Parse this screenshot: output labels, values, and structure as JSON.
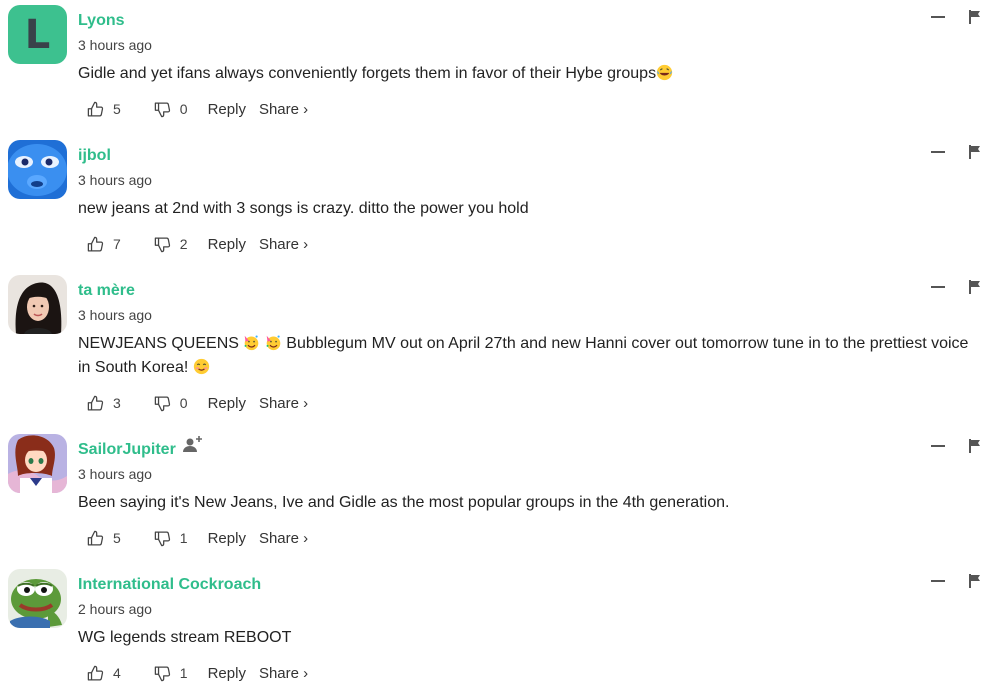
{
  "comments": [
    {
      "avatar_letter": "L",
      "username": "Lyons",
      "timestamp": "3 hours ago",
      "text": "Gidle and yet ifans always conveniently forgets them in favor of their Hybe groups",
      "likes": "5",
      "dislikes": "0",
      "reply_label": "Reply",
      "share_label": "Share ›"
    },
    {
      "username": "ijbol",
      "timestamp": "3 hours ago",
      "text": "new jeans at 2nd with 3 songs is crazy. ditto the power you hold",
      "likes": "7",
      "dislikes": "2",
      "reply_label": "Reply",
      "share_label": "Share ›"
    },
    {
      "username": "ta mère",
      "timestamp": "3 hours ago",
      "text_part1": "NEWJEANS QUEENS",
      "text_part2": "Bubblegum MV out on April 27th and new Hanni cover out tomorrow tune in to the prettiest voice in South Korea!",
      "likes": "3",
      "dislikes": "0",
      "reply_label": "Reply",
      "share_label": "Share ›"
    },
    {
      "username": "SailorJupiter",
      "timestamp": "3 hours ago",
      "text": "Been saying it's New Jeans, Ive and Gidle as the most popular groups in the 4th generation.",
      "likes": "5",
      "dislikes": "1",
      "reply_label": "Reply",
      "share_label": "Share ›"
    },
    {
      "username": "International Cockroach",
      "timestamp": "2 hours ago",
      "text": "WG legends stream REBOOT",
      "likes": "4",
      "dislikes": "1",
      "reply_label": "Reply",
      "share_label": "Share ›"
    }
  ],
  "colors": {
    "username": "#2fbd8b",
    "letter_avatar_bg": "#3dc18f"
  },
  "icons": [
    "thumbs-up-icon",
    "thumbs-down-icon",
    "minus-icon",
    "flag-icon",
    "follow-user-icon",
    "laughing-emoji",
    "party-emoji",
    "smiling-emoji"
  ]
}
